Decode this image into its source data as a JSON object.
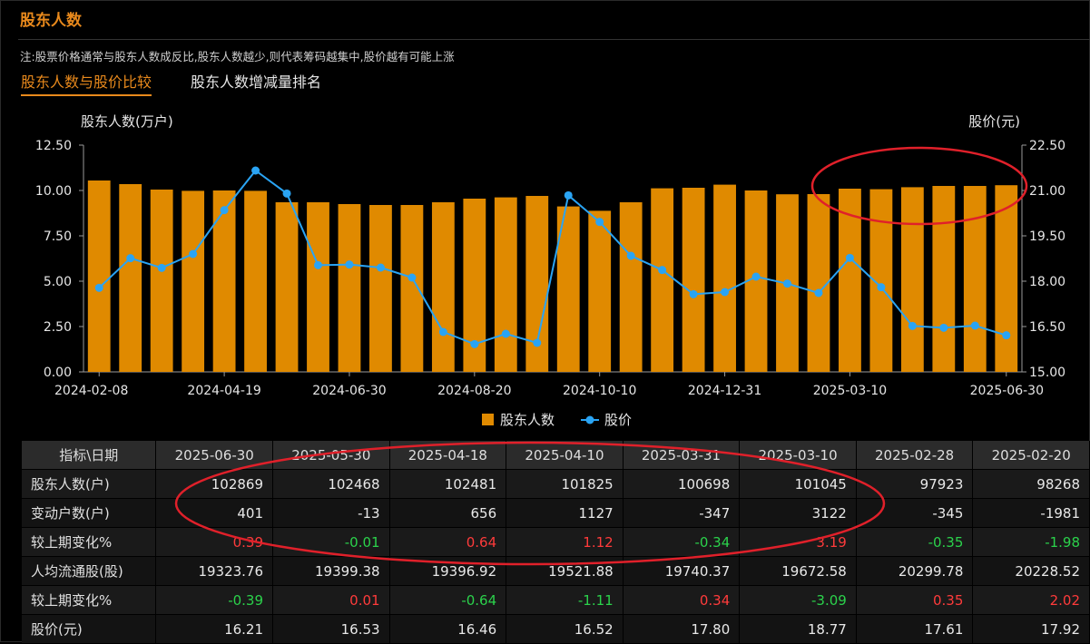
{
  "header": {
    "title": "股东人数",
    "note": "注:股票价格通常与股东人数成反比,股东人数越少,则代表筹码越集中,股价越有可能上涨",
    "tabs": [
      {
        "label": "股东人数与股价比较",
        "active": true
      },
      {
        "label": "股东人数增减量排名",
        "active": false
      }
    ]
  },
  "colors": {
    "bar": "#e08a00",
    "line": "#2aa4f4",
    "accent": "#e8891c",
    "red": "#ff3b3b",
    "green": "#2bd24b",
    "annotation": "#e0202a"
  },
  "chart_data": {
    "type": "bar",
    "y_left_label": "股东人数(万户)",
    "y_right_label": "股价(元)",
    "y_left_range": [
      0,
      12.5
    ],
    "y_left_ticks": [
      "0.00",
      "2.50",
      "5.00",
      "7.50",
      "10.00",
      "12.50"
    ],
    "y_right_range": [
      15,
      22.5
    ],
    "y_right_ticks": [
      "15.00",
      "16.50",
      "18.00",
      "19.50",
      "21.00",
      "22.50"
    ],
    "x_tick_labels": [
      {
        "index": 0,
        "label": "2024-02-08"
      },
      {
        "index": 4,
        "label": "2024-04-19"
      },
      {
        "index": 8,
        "label": "2024-06-30"
      },
      {
        "index": 12,
        "label": "2024-08-20"
      },
      {
        "index": 16,
        "label": "2024-10-10"
      },
      {
        "index": 20,
        "label": "2024-12-31"
      },
      {
        "index": 24,
        "label": "2025-03-10"
      },
      {
        "index": 29,
        "label": "2025-06-30"
      }
    ],
    "legend": [
      {
        "name": "股东人数",
        "kind": "bar"
      },
      {
        "name": "股价",
        "kind": "line"
      }
    ],
    "legend_position": "bottom-center",
    "grid": false,
    "series": [
      {
        "name": "股东人数",
        "kind": "bar",
        "axis": "left",
        "values": [
          10.55,
          10.35,
          10.05,
          9.98,
          10.0,
          9.98,
          9.35,
          9.35,
          9.25,
          9.2,
          9.2,
          9.35,
          9.55,
          9.62,
          9.7,
          9.12,
          8.88,
          9.35,
          10.12,
          10.15,
          10.32,
          10.0,
          9.79,
          9.8,
          10.1,
          10.07,
          10.18,
          10.25,
          10.25,
          10.29
        ]
      },
      {
        "name": "股价",
        "kind": "line",
        "axis": "right",
        "values": [
          17.78,
          18.76,
          18.44,
          18.9,
          20.35,
          21.66,
          20.9,
          18.53,
          18.55,
          18.45,
          18.12,
          16.32,
          15.92,
          16.26,
          15.96,
          20.84,
          19.96,
          18.84,
          18.37,
          17.57,
          17.64,
          18.15,
          17.92,
          17.61,
          18.77,
          17.8,
          16.52,
          16.46,
          16.53,
          16.21
        ]
      }
    ]
  },
  "table": {
    "corner": "指标\\日期",
    "columns": [
      "2025-06-30",
      "2025-05-30",
      "2025-04-18",
      "2025-04-10",
      "2025-03-31",
      "2025-03-10",
      "2025-02-28",
      "2025-02-20"
    ],
    "rows": [
      {
        "label": "股东人数(户)",
        "cells": [
          {
            "v": "102869"
          },
          {
            "v": "102468"
          },
          {
            "v": "102481"
          },
          {
            "v": "101825"
          },
          {
            "v": "100698"
          },
          {
            "v": "101045"
          },
          {
            "v": "97923"
          },
          {
            "v": "98268"
          }
        ]
      },
      {
        "label": "变动户数(户)",
        "cells": [
          {
            "v": "401"
          },
          {
            "v": "-13"
          },
          {
            "v": "656"
          },
          {
            "v": "1127"
          },
          {
            "v": "-347"
          },
          {
            "v": "3122"
          },
          {
            "v": "-345"
          },
          {
            "v": "-1981"
          }
        ]
      },
      {
        "label": "较上期变化%",
        "cells": [
          {
            "v": "0.39",
            "c": "red"
          },
          {
            "v": "-0.01",
            "c": "green"
          },
          {
            "v": "0.64",
            "c": "red"
          },
          {
            "v": "1.12",
            "c": "red"
          },
          {
            "v": "-0.34",
            "c": "green"
          },
          {
            "v": "3.19",
            "c": "red"
          },
          {
            "v": "-0.35",
            "c": "green"
          },
          {
            "v": "-1.98",
            "c": "green"
          }
        ]
      },
      {
        "label": "人均流通股(股)",
        "cells": [
          {
            "v": "19323.76"
          },
          {
            "v": "19399.38"
          },
          {
            "v": "19396.92"
          },
          {
            "v": "19521.88"
          },
          {
            "v": "19740.37"
          },
          {
            "v": "19672.58"
          },
          {
            "v": "20299.78"
          },
          {
            "v": "20228.52"
          }
        ]
      },
      {
        "label": "较上期变化%",
        "cells": [
          {
            "v": "-0.39",
            "c": "green"
          },
          {
            "v": "0.01",
            "c": "red"
          },
          {
            "v": "-0.64",
            "c": "green"
          },
          {
            "v": "-1.11",
            "c": "green"
          },
          {
            "v": "0.34",
            "c": "red"
          },
          {
            "v": "-3.09",
            "c": "green"
          },
          {
            "v": "0.35",
            "c": "red"
          },
          {
            "v": "2.02",
            "c": "red"
          }
        ]
      },
      {
        "label": "股价(元)",
        "cells": [
          {
            "v": "16.21"
          },
          {
            "v": "16.53"
          },
          {
            "v": "16.46"
          },
          {
            "v": "16.52"
          },
          {
            "v": "17.80"
          },
          {
            "v": "18.77"
          },
          {
            "v": "17.61"
          },
          {
            "v": "17.92"
          }
        ]
      }
    ]
  }
}
